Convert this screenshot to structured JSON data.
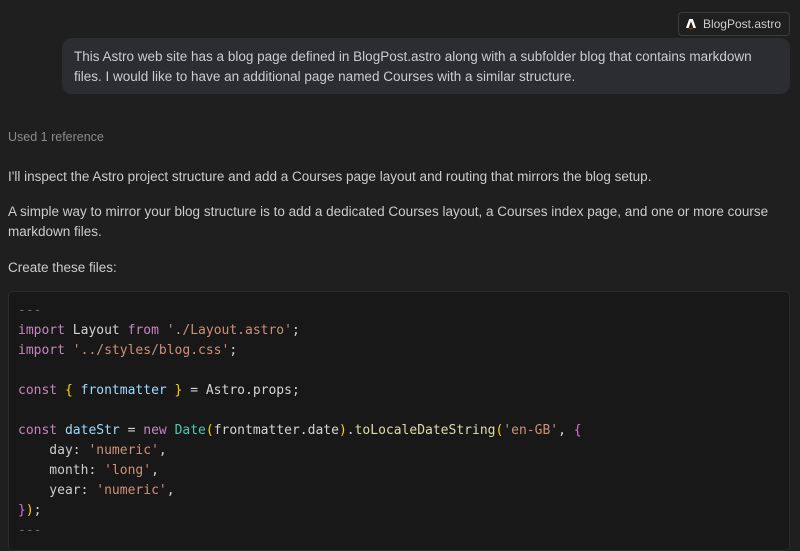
{
  "attachment": {
    "label": "BlogPost.astro",
    "icon": "astro-logo-icon"
  },
  "user_message": "This Astro web site has a blog page defined in BlogPost.astro along with a subfolder blog that contains markdown files. I would like to have an additional page named Courses with a similar structure.",
  "references_label": "Used 1 reference",
  "response": {
    "p1": "I'll inspect the Astro project structure and add a Courses page layout and routing that mirrors the blog setup.",
    "p2": "A simple way to mirror your blog structure is to add a dedicated Courses layout, a Courses index page, and one or more course markdown files.",
    "p3": "Create these files:"
  },
  "code": {
    "l1": {
      "a": "---"
    },
    "l2": {
      "a": "import",
      "b": " Layout ",
      "c": "from",
      "d": " ",
      "e": "'./Layout.astro'",
      "f": ";"
    },
    "l3": {
      "a": "import",
      "b": " ",
      "c": "'../styles/blog.css'",
      "d": ";"
    },
    "l5": {
      "a": "const",
      "b": " ",
      "c": "{",
      "d": " ",
      "e": "frontmatter",
      "f": " ",
      "g": "}",
      "h": " = Astro.props;"
    },
    "l7": {
      "a": "const",
      "b": " ",
      "c": "dateStr",
      "d": " = ",
      "e": "new",
      "f": " ",
      "g": "Date",
      "h": "(",
      "i": "frontmatter.date",
      "j": ")",
      "k": ".",
      "l": "toLocaleDateString",
      "m": "(",
      "n": "'en-GB'",
      "o": ", ",
      "p": "{"
    },
    "l8": {
      "a": "    day: ",
      "b": "'numeric'",
      "c": ","
    },
    "l9": {
      "a": "    month: ",
      "b": "'long'",
      "c": ","
    },
    "l10": {
      "a": "    year: ",
      "b": "'numeric'",
      "c": ","
    },
    "l11": {
      "a": "}",
      "b": ")",
      "c": ";"
    },
    "l12": {
      "a": "---"
    }
  }
}
